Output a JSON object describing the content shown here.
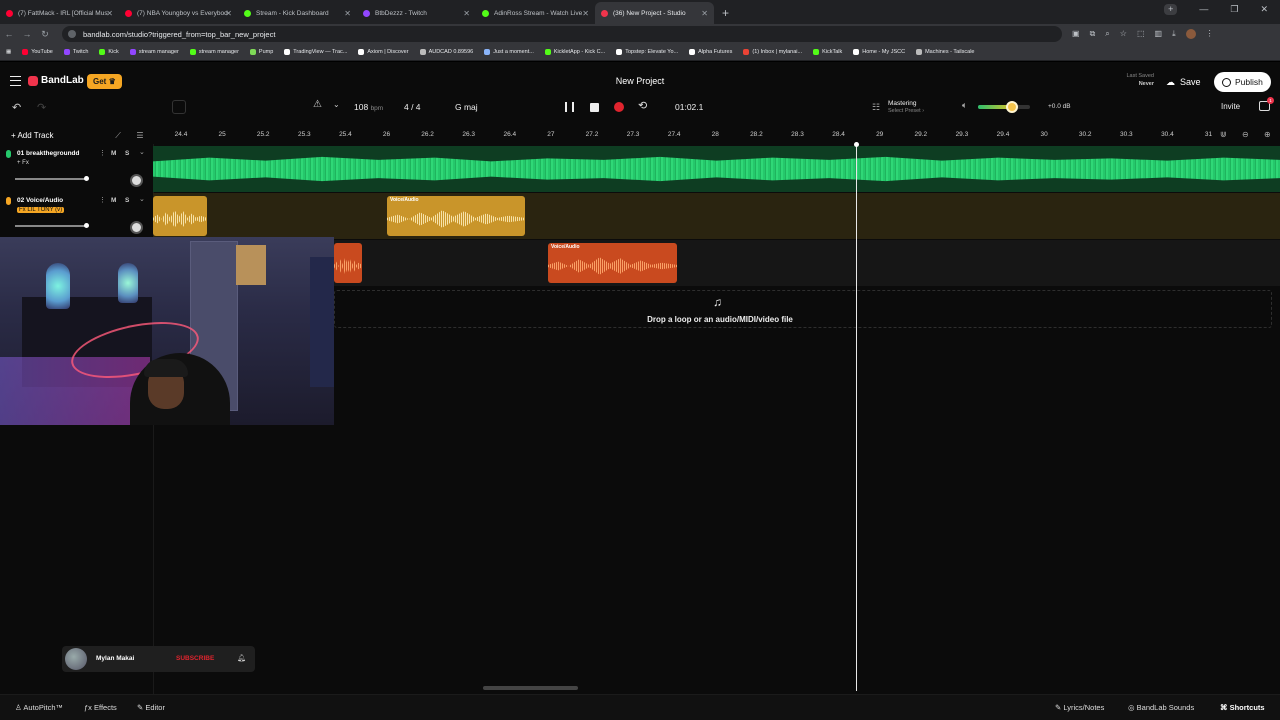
{
  "browser": {
    "tabs": [
      {
        "title": "(7) FattMack - IRL [Official Mus",
        "color": "#ff0033"
      },
      {
        "title": "(7) NBA Youngboy vs Everybod",
        "color": "#ff0033"
      },
      {
        "title": "Stream - Kick Dashboard",
        "color": "#53fc18"
      },
      {
        "title": "BtbDezzz - Twitch",
        "color": "#9146ff"
      },
      {
        "title": "AdinRoss Stream - Watch Live",
        "color": "#53fc18"
      },
      {
        "title": "(36) New Project - Studio",
        "color": "#f0344c"
      }
    ],
    "url": "bandlab.com/studio?triggered_from=top_bar_new_project",
    "bookmarks": [
      {
        "label": "YouTube",
        "color": "#ff0033"
      },
      {
        "label": "Twitch",
        "color": "#9146ff"
      },
      {
        "label": "Kick",
        "color": "#53fc18"
      },
      {
        "label": "stream manager",
        "color": "#9146ff"
      },
      {
        "label": "stream manager",
        "color": "#53fc18"
      },
      {
        "label": "Pump",
        "color": "#7ed957"
      },
      {
        "label": "TradingView — Trac...",
        "color": "#ffffff"
      },
      {
        "label": "Axiom | Discover",
        "color": "#ffffff"
      },
      {
        "label": "AUDCAD 0.89596",
        "color": "#bbbbbb"
      },
      {
        "label": "Just a moment...",
        "color": "#8ab4f8"
      },
      {
        "label": "KickletApp - Kick C...",
        "color": "#53fc18"
      },
      {
        "label": "Topstep: Elevate Yo...",
        "color": "#ffffff"
      },
      {
        "label": "Alpha Futures",
        "color": "#ffffff"
      },
      {
        "label": "(1) Inbox | mylanai...",
        "color": "#ea4335"
      },
      {
        "label": "KickTalk",
        "color": "#53fc18"
      },
      {
        "label": "Home - My JSCC",
        "color": "#ffffff"
      },
      {
        "label": "Machines - Tailscale",
        "color": "#bbbbbb"
      }
    ]
  },
  "app": {
    "brand": "BandLab",
    "get_label": "Get",
    "project_title": "New Project",
    "last_saved_label": "Last Saved",
    "last_saved_value": "Never",
    "save_label": "Save",
    "publish_label": "Publish",
    "invite_label": "Invite",
    "gift_badge": "1"
  },
  "transport": {
    "bpm": "108",
    "bpm_unit": "bpm",
    "time_signature": "4 / 4",
    "key": "G maj",
    "timecode": "01:02.1",
    "mastering_title": "Mastering",
    "mastering_subtitle": "Select Preset",
    "volume_db": "+0.0 dB",
    "volume_level": 0.66
  },
  "tracks_panel": {
    "add_track_label": "Add Track",
    "tracks": [
      {
        "number_name": "01  breakthegroundd",
        "fx": "+ Fx",
        "mute": "M",
        "solo": "S",
        "color": "#25c86b"
      },
      {
        "number_name": "02  Voice/Audio",
        "fx": "Fx LIL TONY (v)",
        "mute": "M",
        "solo": "S",
        "color": "#f5a623"
      }
    ]
  },
  "ruler": {
    "ticks": [
      "24.4",
      "25",
      "25.2",
      "25.3",
      "25.4",
      "26",
      "26.2",
      "26.3",
      "26.4",
      "27",
      "27.2",
      "27.3",
      "27.4",
      "28",
      "28.2",
      "28.3",
      "28.4",
      "29",
      "29.2",
      "29.3",
      "29.4",
      "30",
      "30.2",
      "30.3",
      "30.4",
      "31"
    ]
  },
  "clips": {
    "voice_label": "Voice/Audio"
  },
  "drop_zone_text": "Drop a loop or an audio/MIDI/video file",
  "social_overlay": {
    "name": "Mylan Makai",
    "subscribe": "SUBSCRIBE"
  },
  "bottombar": {
    "autopitch": "AutoPitch™",
    "effects": "Effects",
    "editor": "Editor",
    "lyrics": "Lyrics/Notes",
    "sounds": "BandLab Sounds",
    "shortcuts": "Shortcuts"
  }
}
